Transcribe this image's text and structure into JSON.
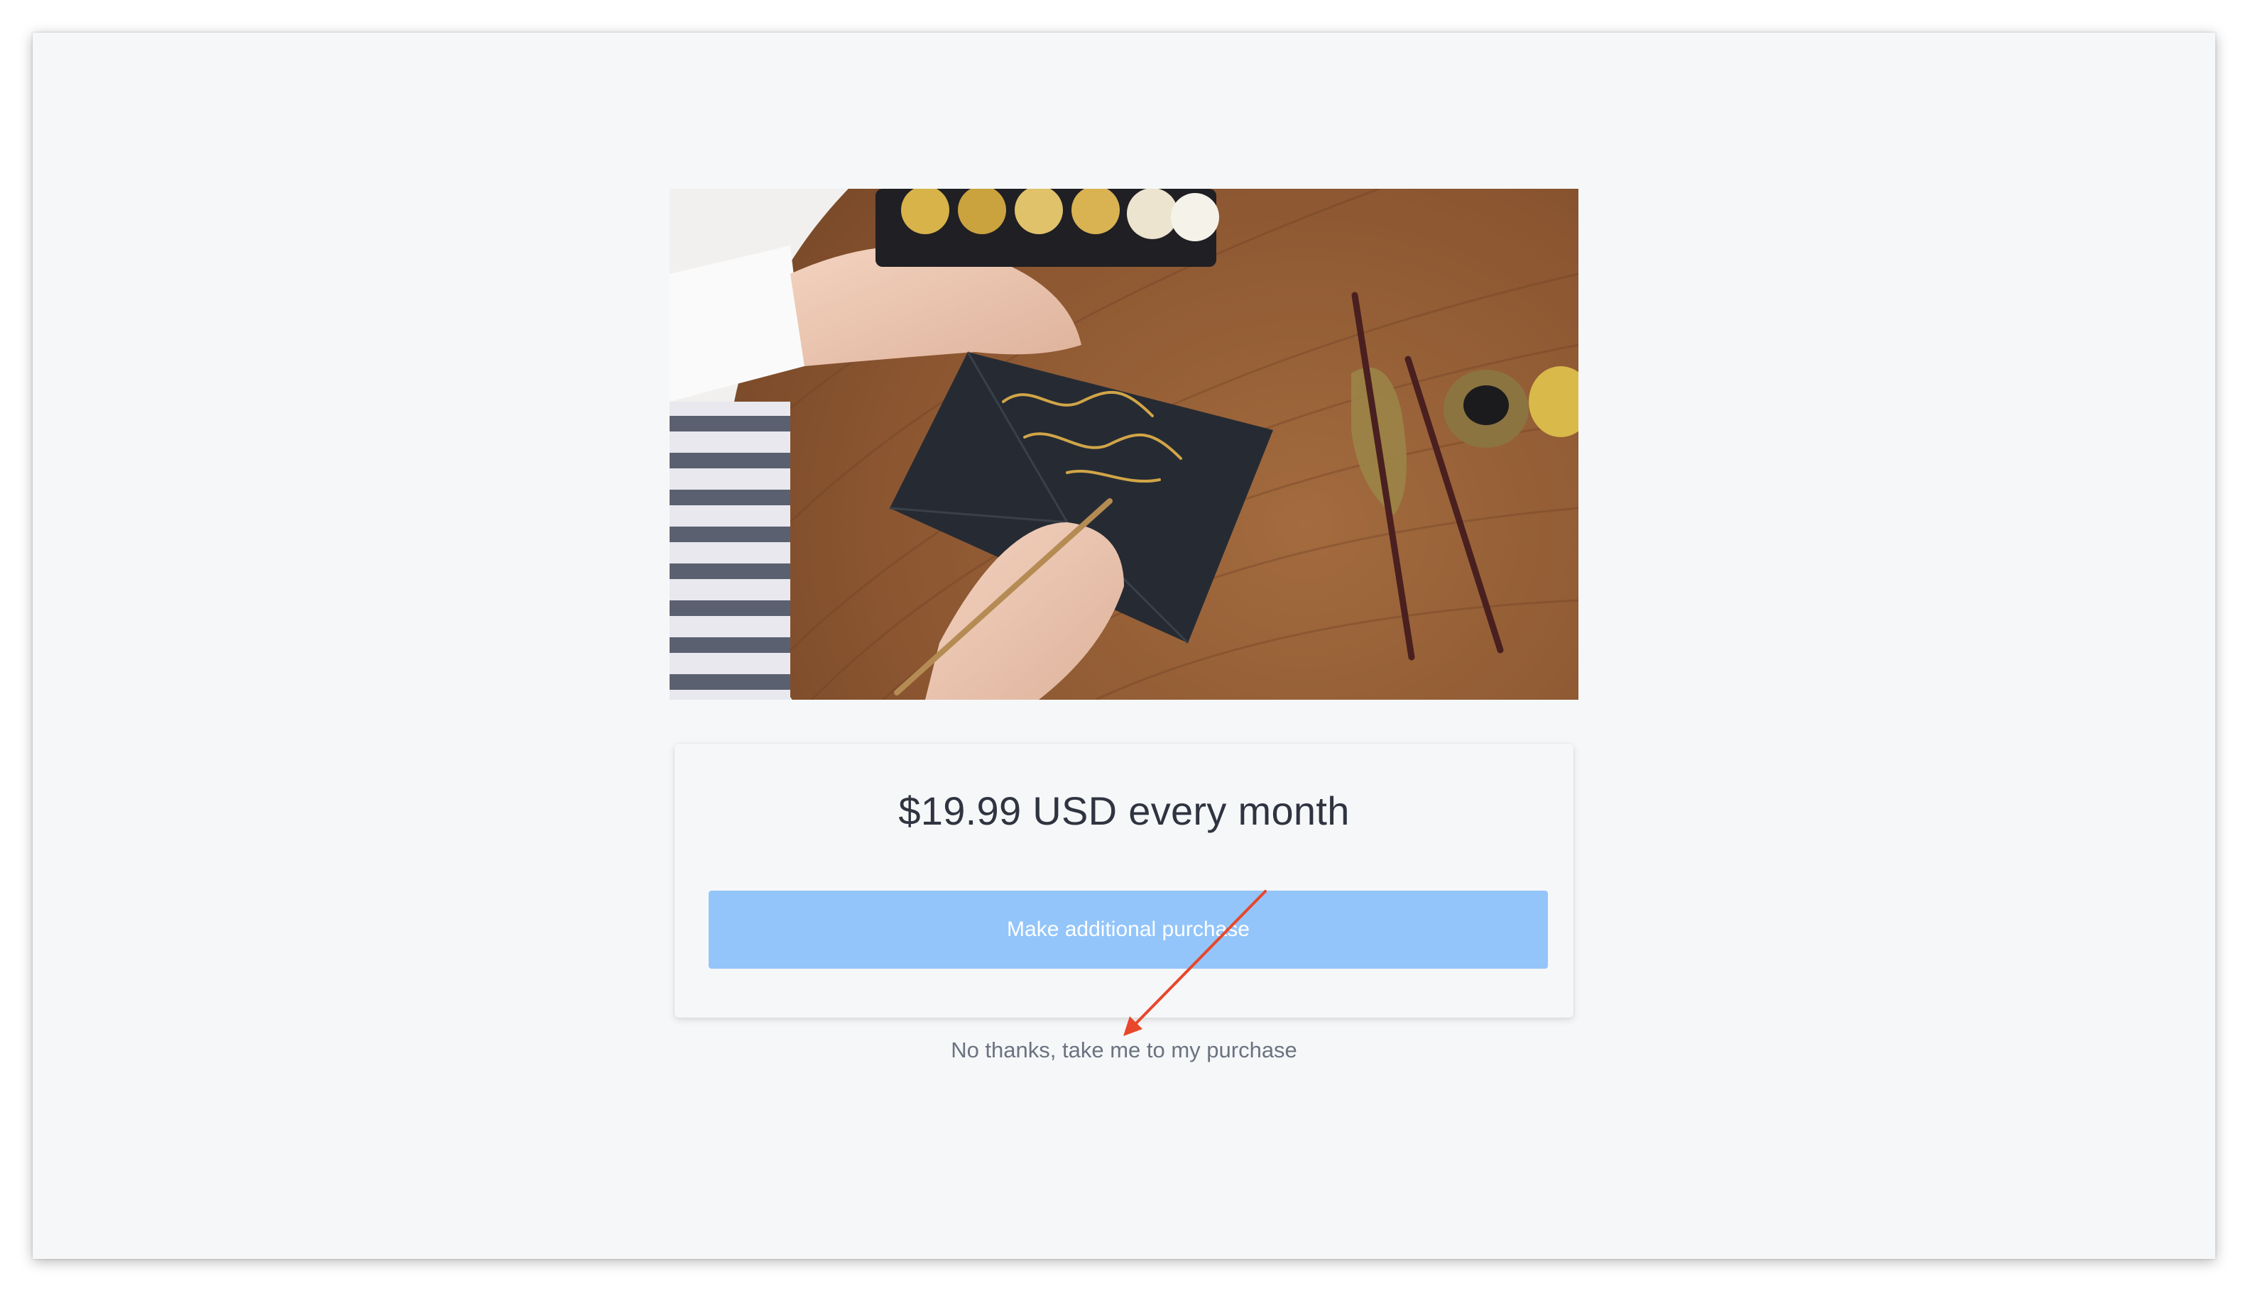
{
  "offer": {
    "price_text": "$19.99 USD every month",
    "purchase_button_label": "Make additional purchase",
    "decline_link_text": "No thanks, take me to my purchase"
  },
  "colors": {
    "page_background": "#f6f7f9",
    "button_background": "#93c5fa",
    "button_text": "#ffffff",
    "price_text": "#2f3440",
    "link_text": "#6b7380",
    "annotation_arrow": "#e8472b"
  },
  "icons": {
    "annotation": "red-arrow-icon"
  }
}
